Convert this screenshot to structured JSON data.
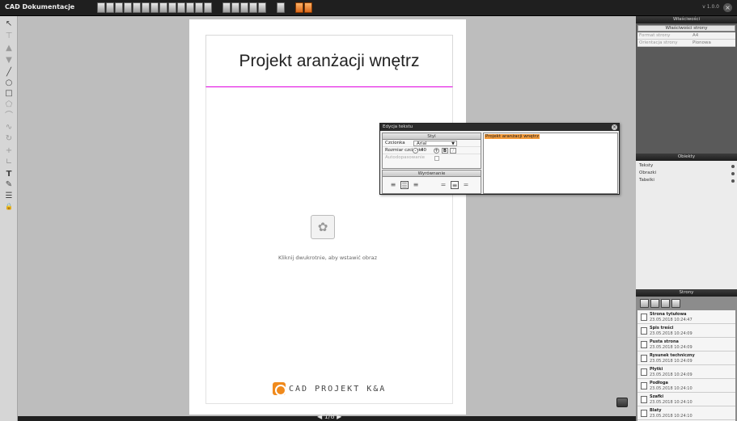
{
  "app": {
    "title": "CAD Dokumentacje",
    "version": "v 1.0.0",
    "close": "×"
  },
  "leftbar": {
    "tools": [
      {
        "name": "select-tool",
        "glyph": "↖"
      },
      {
        "name": "align-top-tool",
        "glyph": "⊤"
      },
      {
        "name": "move-up-tool",
        "glyph": "▲"
      },
      {
        "name": "move-down-tool",
        "glyph": "▼"
      },
      {
        "name": "line-tool",
        "glyph": "╱"
      },
      {
        "name": "circle-tool",
        "glyph": "○"
      },
      {
        "name": "rectangle-tool",
        "glyph": "□"
      },
      {
        "name": "polygon-tool",
        "glyph": "⬠"
      },
      {
        "name": "arc-tool",
        "glyph": "⌒"
      },
      {
        "name": "curve-tool",
        "glyph": "∿"
      },
      {
        "name": "rotate-tool",
        "glyph": "↻"
      },
      {
        "name": "crosshair-tool",
        "glyph": "+"
      },
      {
        "name": "dimension-tool",
        "glyph": "∟"
      },
      {
        "name": "text-tool",
        "glyph": "T"
      },
      {
        "name": "brush-tool",
        "glyph": "✎"
      },
      {
        "name": "layers-tool",
        "glyph": "☰"
      },
      {
        "name": "lock-tool",
        "glyph": "🔒"
      }
    ]
  },
  "canvas": {
    "page_title": "Projekt aranżacji wnętrz",
    "image_placeholder_icon": "✿",
    "image_placeholder_text": "Kliknij dwukrotnie, aby wstawić obraz",
    "footer_brand": "CAD PROJEKT K&A"
  },
  "text_dialog": {
    "title": "Edycja tekstu",
    "close": "×",
    "style_section": "Styl",
    "font_label": "Czcionka",
    "font_value": "Arial",
    "size_label": "Rozmiar czcionki",
    "size_value": "40",
    "autofit_label": "Autodopasowanie",
    "bold": "B",
    "italic": "I",
    "align_section": "Wyrównanie",
    "align_buttons": [
      "≡",
      "☰",
      "≡",
      "=",
      "≡",
      "="
    ],
    "edit_text": "Projekt aranżacji wnętrz"
  },
  "right_panel": {
    "properties_header": "Właściwości",
    "page_props_sub": "Właściwości strony",
    "props": [
      {
        "key": "Format strony",
        "value": "A4"
      },
      {
        "key": "Orientacja strony",
        "value": "Pionowa"
      }
    ],
    "objects_header": "Obiekty",
    "objects": [
      "Teksty",
      "Obrazki",
      "Tabelki"
    ],
    "pages_header": "Strony",
    "pages": [
      {
        "name": "Strona tytułowa",
        "date": "23.05.2018 10:24:47"
      },
      {
        "name": "Spis treści",
        "date": "23.05.2018 10:24:09"
      },
      {
        "name": "Pusta strona",
        "date": "23.05.2018 10:24:09"
      },
      {
        "name": "Rysunek techniczny",
        "date": "23.05.2018 10:24:09"
      },
      {
        "name": "Płytki",
        "date": "23.05.2018 10:24:09"
      },
      {
        "name": "Podłoga",
        "date": "23.05.2018 10:24:10"
      },
      {
        "name": "Szafki",
        "date": "23.05.2018 10:24:10"
      },
      {
        "name": "Blaty",
        "date": "23.05.2018 10:24:10"
      }
    ]
  },
  "bottom": {
    "pager": "◀ 1/8 ▶"
  }
}
